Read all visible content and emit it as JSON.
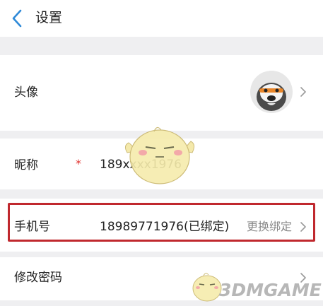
{
  "header": {
    "title": "设置"
  },
  "rows": {
    "avatar": {
      "label": "头像"
    },
    "nickname": {
      "label": "昵称",
      "required_mark": "*",
      "value": "189xxxx1976"
    },
    "phone": {
      "label": "手机号",
      "value": "18989771976(已绑定)",
      "action": "更换绑定"
    },
    "password": {
      "label": "修改密码"
    }
  },
  "watermark": {
    "text": "3DMGAME"
  },
  "colors": {
    "highlight_border": "#c0282e",
    "separator": "#efeff1",
    "back_arrow": "#2f8ad8",
    "required": "#e0302d"
  },
  "icons": [
    "back-arrow-icon",
    "chevron-right-icon",
    "avatar-image",
    "mascot-watermark"
  ]
}
